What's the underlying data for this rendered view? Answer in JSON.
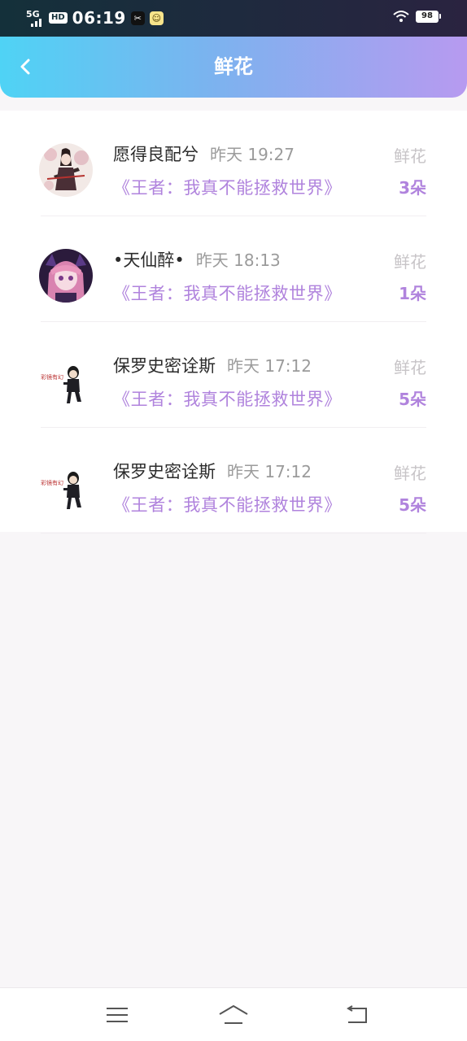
{
  "status_bar": {
    "network": "5G",
    "hd": "HD",
    "time": "06:19",
    "battery": "98"
  },
  "header": {
    "title": "鲜花"
  },
  "records": [
    {
      "name": "愿得良配兮",
      "time": "昨天 19:27",
      "book": "《王者：我真不能拯救世界》",
      "label": "鲜花",
      "count": "3朵"
    },
    {
      "name": "•天仙醉•",
      "time": "昨天 18:13",
      "book": "《王者：我真不能拯救世界》",
      "label": "鲜花",
      "count": "1朵"
    },
    {
      "name": "保罗史密诠斯",
      "time": "昨天 17:12",
      "book": "《王者：我真不能拯救世界》",
      "label": "鲜花",
      "count": "5朵"
    },
    {
      "name": "保罗史密诠斯",
      "time": "昨天 17:12",
      "book": "《王者：我真不能拯救世界》",
      "label": "鲜花",
      "count": "5朵"
    }
  ],
  "colors": {
    "accent": "#b083dd",
    "header_start": "#4fd3f5",
    "header_end": "#b79af0"
  },
  "icons": {
    "back": "chevron-left-icon",
    "menu": "menu-icon",
    "home": "home-icon",
    "return": "return-icon"
  }
}
